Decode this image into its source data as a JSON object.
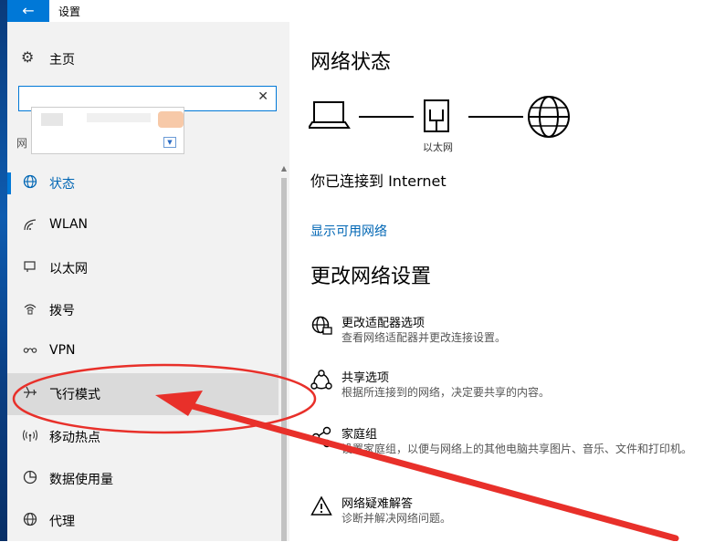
{
  "window": {
    "title": "设置",
    "back_icon": "arrow-left-icon"
  },
  "sidebar": {
    "home_label": "主页",
    "search": {
      "value": "",
      "placeholder": ""
    },
    "group_label": "网",
    "items": [
      {
        "label": "状态",
        "icon": "globe-icon",
        "active": true
      },
      {
        "label": "WLAN",
        "icon": "wifi-icon"
      },
      {
        "label": "以太网",
        "icon": "ethernet-icon"
      },
      {
        "label": "拨号",
        "icon": "dialup-icon"
      },
      {
        "label": "VPN",
        "icon": "vpn-icon"
      },
      {
        "label": "飞行模式",
        "icon": "airplane-icon",
        "highlighted": true
      },
      {
        "label": "移动热点",
        "icon": "hotspot-icon"
      },
      {
        "label": "数据使用量",
        "icon": "data-usage-icon"
      },
      {
        "label": "代理",
        "icon": "globe-icon"
      }
    ]
  },
  "main": {
    "status_heading": "网络状态",
    "diagram_caption": "以太网",
    "connected_text": "你已连接到 Internet",
    "show_networks_link": "显示可用网络",
    "change_heading": "更改网络设置",
    "options": [
      {
        "title": "更改适配器选项",
        "desc": "查看网络适配器并更改连接设置。",
        "icon": "adapter-globe-icon"
      },
      {
        "title": "共享选项",
        "desc": "根据所连接到的网络，决定要共享的内容。",
        "icon": "sharing-icon"
      },
      {
        "title": "家庭组",
        "desc": "设置家庭组，以便与网络上的其他电脑共享图片、音乐、文件和打印机。",
        "icon": "homegroup-icon"
      },
      {
        "title": "网络疑难解答",
        "desc": "诊断并解决网络问题。",
        "icon": "warning-icon"
      }
    ]
  },
  "colors": {
    "accent": "#0078d7",
    "annotation": "#e8302a"
  }
}
